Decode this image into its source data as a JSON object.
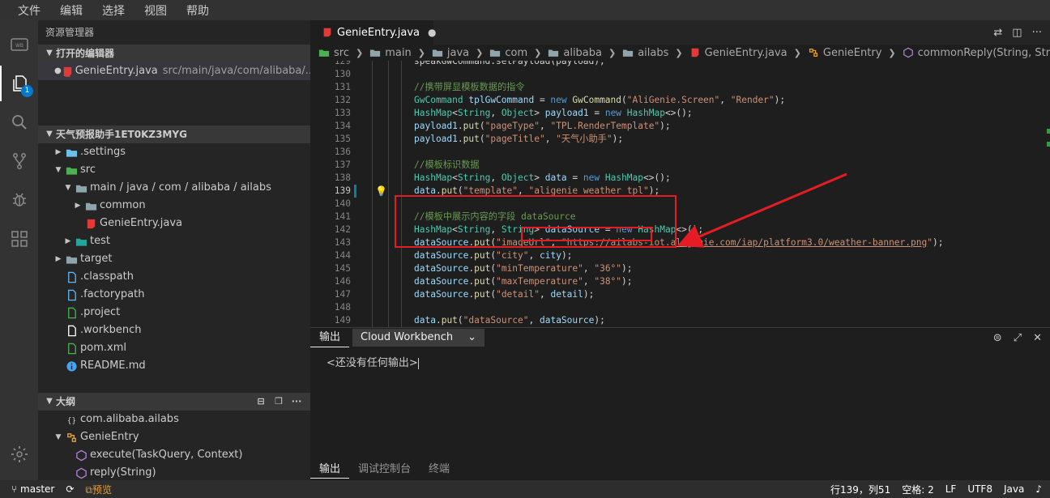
{
  "menu": [
    "文件",
    "编辑",
    "选择",
    "视图",
    "帮助"
  ],
  "activity": {
    "badge": "1"
  },
  "sidebar": {
    "title": "资源管理器",
    "open_editors": {
      "header": "打开的编辑器",
      "items": [
        {
          "name": "GenieEntry.java",
          "path": "src/main/java/com/alibaba/..."
        }
      ]
    },
    "project": {
      "header": "天气预报助手1ET0KZ3MYG",
      "tree": [
        {
          "label": ".settings",
          "depth": 1,
          "chevron": "closed",
          "icon": "settings-folder-icon",
          "color": "#6bc2e8"
        },
        {
          "label": "src",
          "depth": 1,
          "chevron": "open",
          "icon": "src-folder-icon",
          "color": "#4caf50"
        },
        {
          "label": "main / java / com / alibaba / ailabs",
          "depth": 2,
          "chevron": "open",
          "icon": "folder-icon",
          "color": "#90a4ae"
        },
        {
          "label": "common",
          "depth": 3,
          "chevron": "closed",
          "icon": "folder-icon",
          "color": "#90a4ae"
        },
        {
          "label": "GenieEntry.java",
          "depth": 3,
          "chevron": "none",
          "icon": "java-file-icon",
          "color": "#e53935"
        },
        {
          "label": "test",
          "depth": 2,
          "chevron": "closed",
          "icon": "test-folder-icon",
          "color": "#26a69a"
        },
        {
          "label": "target",
          "depth": 1,
          "chevron": "closed",
          "icon": "folder-icon",
          "color": "#90a4ae"
        },
        {
          "label": ".classpath",
          "depth": 1,
          "chevron": "none",
          "icon": "file-icon",
          "color": "#64b5f6"
        },
        {
          "label": ".factorypath",
          "depth": 1,
          "chevron": "none",
          "icon": "file-icon",
          "color": "#64b5f6"
        },
        {
          "label": ".project",
          "depth": 1,
          "chevron": "none",
          "icon": "project-file-icon",
          "color": "#4caf50"
        },
        {
          "label": ".workbench",
          "depth": 1,
          "chevron": "none",
          "icon": "workbench-file-icon",
          "color": "#ffffff"
        },
        {
          "label": "pom.xml",
          "depth": 1,
          "chevron": "none",
          "icon": "maven-file-icon",
          "color": "#4caf50"
        },
        {
          "label": "README.md",
          "depth": 1,
          "chevron": "none",
          "icon": "info-file-icon",
          "color": "#42a5f5"
        }
      ]
    },
    "outline": {
      "header": "大纲",
      "items": [
        {
          "label": "com.alibaba.ailabs",
          "depth": 1,
          "chevron": "none",
          "icon": "package-icon",
          "color": "#cccccc"
        },
        {
          "label": "GenieEntry",
          "depth": 1,
          "chevron": "open",
          "icon": "class-icon",
          "color": "#ee9d28"
        },
        {
          "label": "execute(TaskQuery, Context)",
          "depth": 2,
          "chevron": "none",
          "icon": "method-icon",
          "color": "#b180d7"
        },
        {
          "label": "reply(String)",
          "depth": 2,
          "chevron": "none",
          "icon": "method-icon",
          "color": "#b180d7"
        }
      ]
    }
  },
  "editor": {
    "tab": {
      "label": "GenieEntry.java",
      "dirty": "●"
    },
    "breadcrumb": [
      "src",
      "main",
      "java",
      "com",
      "alibaba",
      "ailabs",
      "GenieEntry.java",
      "GenieEntry",
      "commonReply(String, String, String)"
    ],
    "current_line": 139,
    "lines": [
      {
        "n": "129",
        "code": [
          [
            "",
            "speakGwCommand.setPayload(payload);"
          ]
        ]
      },
      {
        "n": "130",
        "code": []
      },
      {
        "n": "131",
        "code": [
          [
            "com",
            "//携带屏显模板数据的指令"
          ]
        ]
      },
      {
        "n": "132",
        "code": [
          [
            "type",
            "GwCommand"
          ],
          [
            "",
            " "
          ],
          [
            "var",
            "tplGwCommand"
          ],
          [
            "",
            " = "
          ],
          [
            "kw",
            "new"
          ],
          [
            "",
            " "
          ],
          [
            "fn",
            "GwCommand"
          ],
          [
            "",
            "("
          ],
          [
            "str",
            "\"AliGenie.Screen\""
          ],
          [
            "",
            ", "
          ],
          [
            "str",
            "\"Render\""
          ],
          [
            "",
            ");"
          ]
        ]
      },
      {
        "n": "133",
        "code": [
          [
            "type",
            "HashMap"
          ],
          [
            "",
            "<"
          ],
          [
            "type",
            "String"
          ],
          [
            "",
            ", "
          ],
          [
            "type",
            "Object"
          ],
          [
            "",
            "> "
          ],
          [
            "var",
            "payload1"
          ],
          [
            "",
            " = "
          ],
          [
            "kw",
            "new"
          ],
          [
            "",
            " "
          ],
          [
            "type",
            "HashMap"
          ],
          [
            "",
            "<>();"
          ]
        ]
      },
      {
        "n": "134",
        "code": [
          [
            "var",
            "payload1"
          ],
          [
            "",
            "."
          ],
          [
            "fn",
            "put"
          ],
          [
            "",
            "("
          ],
          [
            "str",
            "\"pageType\""
          ],
          [
            "",
            ", "
          ],
          [
            "str",
            "\"TPL.RenderTemplate\""
          ],
          [
            "",
            ");"
          ]
        ]
      },
      {
        "n": "135",
        "code": [
          [
            "var",
            "payload1"
          ],
          [
            "",
            "."
          ],
          [
            "fn",
            "put"
          ],
          [
            "",
            "("
          ],
          [
            "str",
            "\"pageTitle\""
          ],
          [
            "",
            ", "
          ],
          [
            "str",
            "\"天气小助手\""
          ],
          [
            "",
            ");"
          ]
        ]
      },
      {
        "n": "136",
        "code": []
      },
      {
        "n": "137",
        "code": [
          [
            "com",
            "//模板标识数据"
          ]
        ]
      },
      {
        "n": "138",
        "code": [
          [
            "type",
            "HashMap"
          ],
          [
            "",
            "<"
          ],
          [
            "type",
            "String"
          ],
          [
            "",
            ", "
          ],
          [
            "type",
            "Object"
          ],
          [
            "",
            "> "
          ],
          [
            "var",
            "data"
          ],
          [
            "",
            " = "
          ],
          [
            "kw",
            "new"
          ],
          [
            "",
            " "
          ],
          [
            "type",
            "HashMap"
          ],
          [
            "",
            "<>();"
          ]
        ]
      },
      {
        "n": "139",
        "code": [
          [
            "var",
            "data"
          ],
          [
            "",
            "."
          ],
          [
            "fn",
            "put"
          ],
          [
            "",
            "("
          ],
          [
            "str",
            "\"template\""
          ],
          [
            "",
            ", "
          ],
          [
            "str",
            "\"aligenie_weather_tpl\""
          ],
          [
            "",
            ");"
          ]
        ]
      },
      {
        "n": "140",
        "code": []
      },
      {
        "n": "141",
        "code": [
          [
            "com",
            "//模板中展示内容的字段 dataSource"
          ]
        ]
      },
      {
        "n": "142",
        "code": [
          [
            "type",
            "HashMap"
          ],
          [
            "",
            "<"
          ],
          [
            "type",
            "String"
          ],
          [
            "",
            ", "
          ],
          [
            "type",
            "String"
          ],
          [
            "",
            "> "
          ],
          [
            "var",
            "dataSource"
          ],
          [
            "",
            " = "
          ],
          [
            "kw",
            "new"
          ],
          [
            "",
            " "
          ],
          [
            "type",
            "HashMap"
          ],
          [
            "",
            "<>();"
          ]
        ]
      },
      {
        "n": "143",
        "code": [
          [
            "var",
            "dataSource"
          ],
          [
            "",
            "."
          ],
          [
            "fn",
            "put"
          ],
          [
            "",
            "("
          ],
          [
            "str",
            "\"imageUrl\""
          ],
          [
            "",
            ", "
          ],
          [
            "str",
            "\""
          ],
          [
            "url",
            "https://ailabs-iot.aligenie.com/iap/platform3.0/weather-banner.png"
          ],
          [
            "str",
            "\""
          ],
          [
            "",
            ");"
          ]
        ]
      },
      {
        "n": "144",
        "code": [
          [
            "var",
            "dataSource"
          ],
          [
            "",
            "."
          ],
          [
            "fn",
            "put"
          ],
          [
            "",
            "("
          ],
          [
            "str",
            "\"city\""
          ],
          [
            "",
            ", "
          ],
          [
            "var",
            "city"
          ],
          [
            "",
            ");"
          ]
        ]
      },
      {
        "n": "145",
        "code": [
          [
            "var",
            "dataSource"
          ],
          [
            "",
            "."
          ],
          [
            "fn",
            "put"
          ],
          [
            "",
            "("
          ],
          [
            "str",
            "\"minTemperature\""
          ],
          [
            "",
            ", "
          ],
          [
            "str",
            "\"36°\""
          ],
          [
            "",
            ");"
          ]
        ]
      },
      {
        "n": "146",
        "code": [
          [
            "var",
            "dataSource"
          ],
          [
            "",
            "."
          ],
          [
            "fn",
            "put"
          ],
          [
            "",
            "("
          ],
          [
            "str",
            "\"maxTemperature\""
          ],
          [
            "",
            ", "
          ],
          [
            "str",
            "\"38°\""
          ],
          [
            "",
            ");"
          ]
        ]
      },
      {
        "n": "147",
        "code": [
          [
            "var",
            "dataSource"
          ],
          [
            "",
            "."
          ],
          [
            "fn",
            "put"
          ],
          [
            "",
            "("
          ],
          [
            "str",
            "\"detail\""
          ],
          [
            "",
            ", "
          ],
          [
            "var",
            "detail"
          ],
          [
            "",
            ");"
          ]
        ]
      },
      {
        "n": "148",
        "code": []
      },
      {
        "n": "149",
        "code": [
          [
            "var",
            "data"
          ],
          [
            "",
            "."
          ],
          [
            "fn",
            "put"
          ],
          [
            "",
            "("
          ],
          [
            "str",
            "\"dataSource\""
          ],
          [
            "",
            ", "
          ],
          [
            "var",
            "dataSource"
          ],
          [
            "",
            ");"
          ]
        ]
      }
    ]
  },
  "panel": {
    "active_tab": "输出",
    "dropdown": "Cloud Workbench",
    "output": "<还没有任何输出>"
  },
  "bottom_tabs": [
    "输出",
    "调试控制台",
    "终端"
  ],
  "status": {
    "branch": "master",
    "preview": "预览",
    "position": "行139，列51",
    "spaces": "空格: 2",
    "eol": "LF",
    "encoding": "UTF8",
    "language": "Java"
  },
  "colors": {
    "annotation_red": "#e51c23",
    "accent_blue": "#007acc"
  }
}
